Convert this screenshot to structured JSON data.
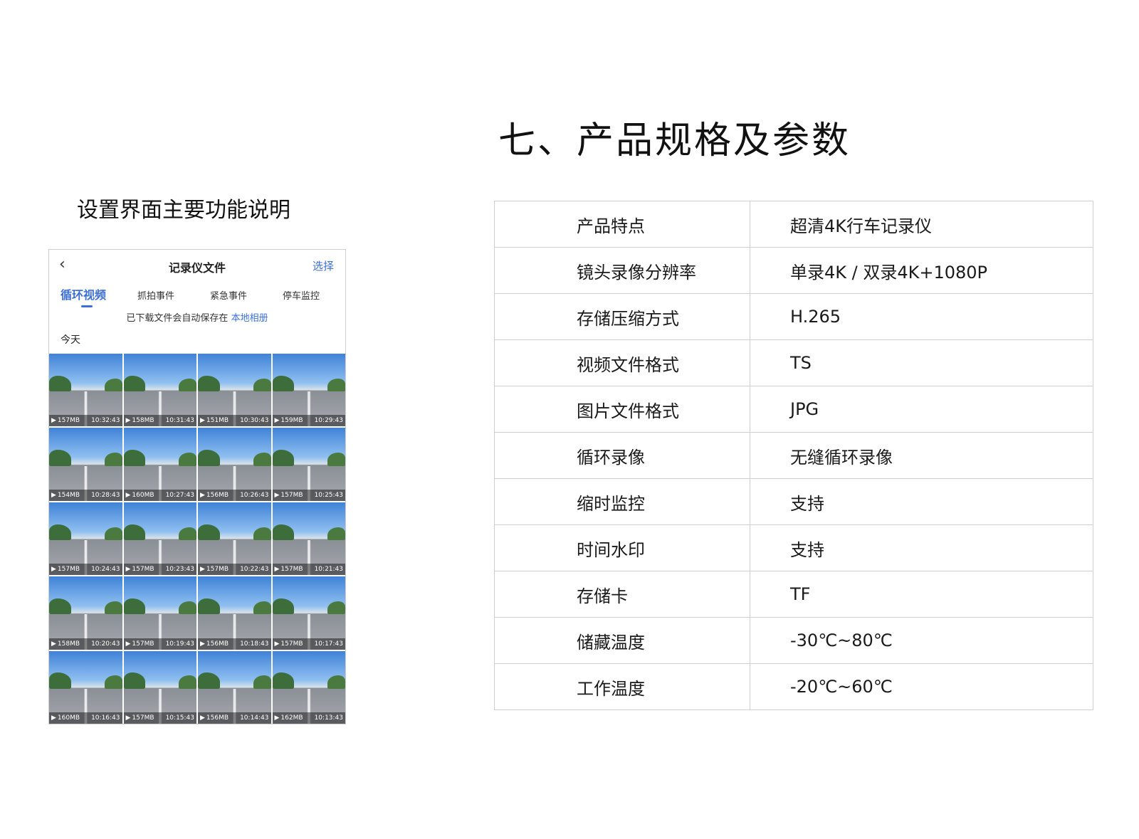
{
  "section_title": "七、产品规格及参数",
  "left_caption": "设置界面主要功能说明",
  "app": {
    "back_icon": "chevron-left-icon",
    "title": "记录仪文件",
    "select_label": "选择",
    "tabs": [
      {
        "label": "循环视频",
        "active": true
      },
      {
        "label": "抓拍事件",
        "active": false
      },
      {
        "label": "紧急事件",
        "active": false
      },
      {
        "label": "停车监控",
        "active": false
      }
    ],
    "notice_text": "已下载文件会自动保存在",
    "notice_link": "本地相册",
    "day_label": "今天",
    "thumbnails": [
      {
        "size": "157MB",
        "time": "10:32:43"
      },
      {
        "size": "158MB",
        "time": "10:31:43"
      },
      {
        "size": "151MB",
        "time": "10:30:43"
      },
      {
        "size": "159MB",
        "time": "10:29:43"
      },
      {
        "size": "154MB",
        "time": "10:28:43"
      },
      {
        "size": "160MB",
        "time": "10:27:43"
      },
      {
        "size": "156MB",
        "time": "10:26:43"
      },
      {
        "size": "157MB",
        "time": "10:25:43"
      },
      {
        "size": "157MB",
        "time": "10:24:43"
      },
      {
        "size": "157MB",
        "time": "10:23:43"
      },
      {
        "size": "157MB",
        "time": "10:22:43"
      },
      {
        "size": "157MB",
        "time": "10:21:43"
      },
      {
        "size": "158MB",
        "time": "10:20:43"
      },
      {
        "size": "157MB",
        "time": "10:19:43"
      },
      {
        "size": "156MB",
        "time": "10:18:43"
      },
      {
        "size": "157MB",
        "time": "10:17:43"
      },
      {
        "size": "160MB",
        "time": "10:16:43"
      },
      {
        "size": "157MB",
        "time": "10:15:43"
      },
      {
        "size": "156MB",
        "time": "10:14:43"
      },
      {
        "size": "162MB",
        "time": "10:13:43"
      }
    ]
  },
  "specs": [
    {
      "key": "产品特点",
      "value": "超清4K行车记录仪"
    },
    {
      "key": "镜头录像分辨率",
      "value": "单录4K / 双录4K+1080P"
    },
    {
      "key": "存储压缩方式",
      "value": "H.265"
    },
    {
      "key": "视频文件格式",
      "value": "TS"
    },
    {
      "key": "图片文件格式",
      "value": "JPG"
    },
    {
      "key": "循环录像",
      "value": "无缝循环录像"
    },
    {
      "key": "缩时监控",
      "value": "支持"
    },
    {
      "key": "时间水印",
      "value": "支持"
    },
    {
      "key": "存储卡",
      "value": "TF"
    },
    {
      "key": "储藏温度",
      "value": "-30℃~80℃"
    },
    {
      "key": "工作温度",
      "value": "-20℃~60℃"
    }
  ]
}
